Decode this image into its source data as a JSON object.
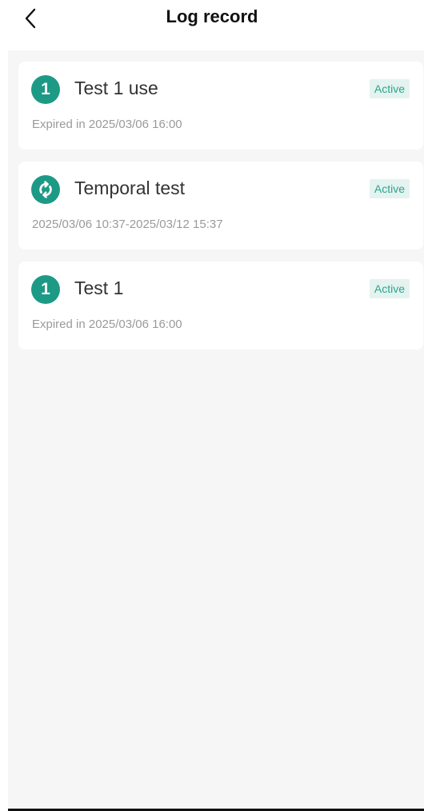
{
  "header": {
    "title": "Log record"
  },
  "records": [
    {
      "icon": "one-badge-icon",
      "icon_text": "1",
      "title": "Test 1 use",
      "status": "Active",
      "subtitle": "Expired in 2025/03/06 16:00"
    },
    {
      "icon": "recurring-icon",
      "title": "Temporal test",
      "status": "Active",
      "subtitle": "2025/03/06 10:37-2025/03/12 15:37"
    },
    {
      "icon": "one-badge-icon",
      "icon_text": "1",
      "title": "Test 1",
      "status": "Active",
      "subtitle": "Expired in 2025/03/06 16:00"
    }
  ],
  "colors": {
    "accent": "#1d9a86",
    "badge_bg": "#e4f3ef",
    "badge_text": "#2ba58e"
  }
}
